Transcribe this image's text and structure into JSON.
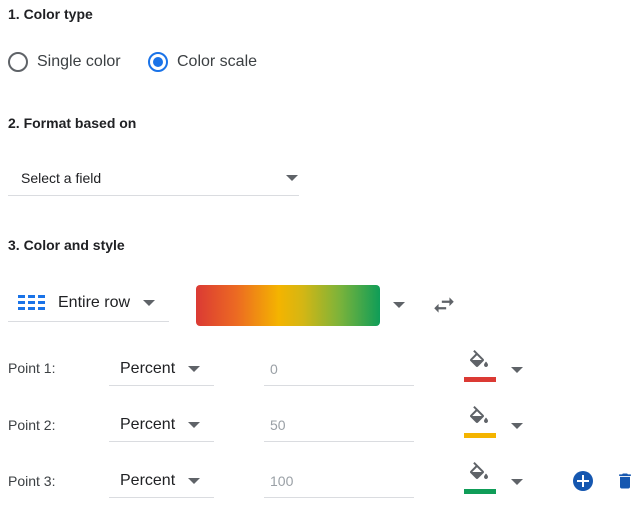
{
  "sections": {
    "color_type": "1. Color type",
    "format_based_on": "2. Format based on",
    "color_and_style": "3. Color and style"
  },
  "color_type_options": [
    {
      "label": "Single color",
      "selected": false
    },
    {
      "label": "Color scale",
      "selected": true
    }
  ],
  "format_field": {
    "value": "Select a field"
  },
  "apply_to": {
    "value": "Entire row",
    "icon": "table-rows-icon"
  },
  "gradient": {
    "colors": [
      "#db3a34",
      "#ec6a22",
      "#f4b400",
      "#7cb33a",
      "#0f9d58"
    ]
  },
  "swap_icon": "swap-horiz-icon",
  "points": [
    {
      "label": "Point 1:",
      "type": "Percent",
      "value": "0",
      "color": "#db3a34"
    },
    {
      "label": "Point 2:",
      "type": "Percent",
      "value": "50",
      "color": "#f4b400"
    },
    {
      "label": "Point 3:",
      "type": "Percent",
      "value": "100",
      "color": "#0f9d58"
    }
  ],
  "actions": {
    "add_icon": "add-circle-icon",
    "delete_icon": "trash-icon"
  },
  "colors": {
    "accent": "#1a73e8",
    "blue_action": "#1557b0"
  }
}
